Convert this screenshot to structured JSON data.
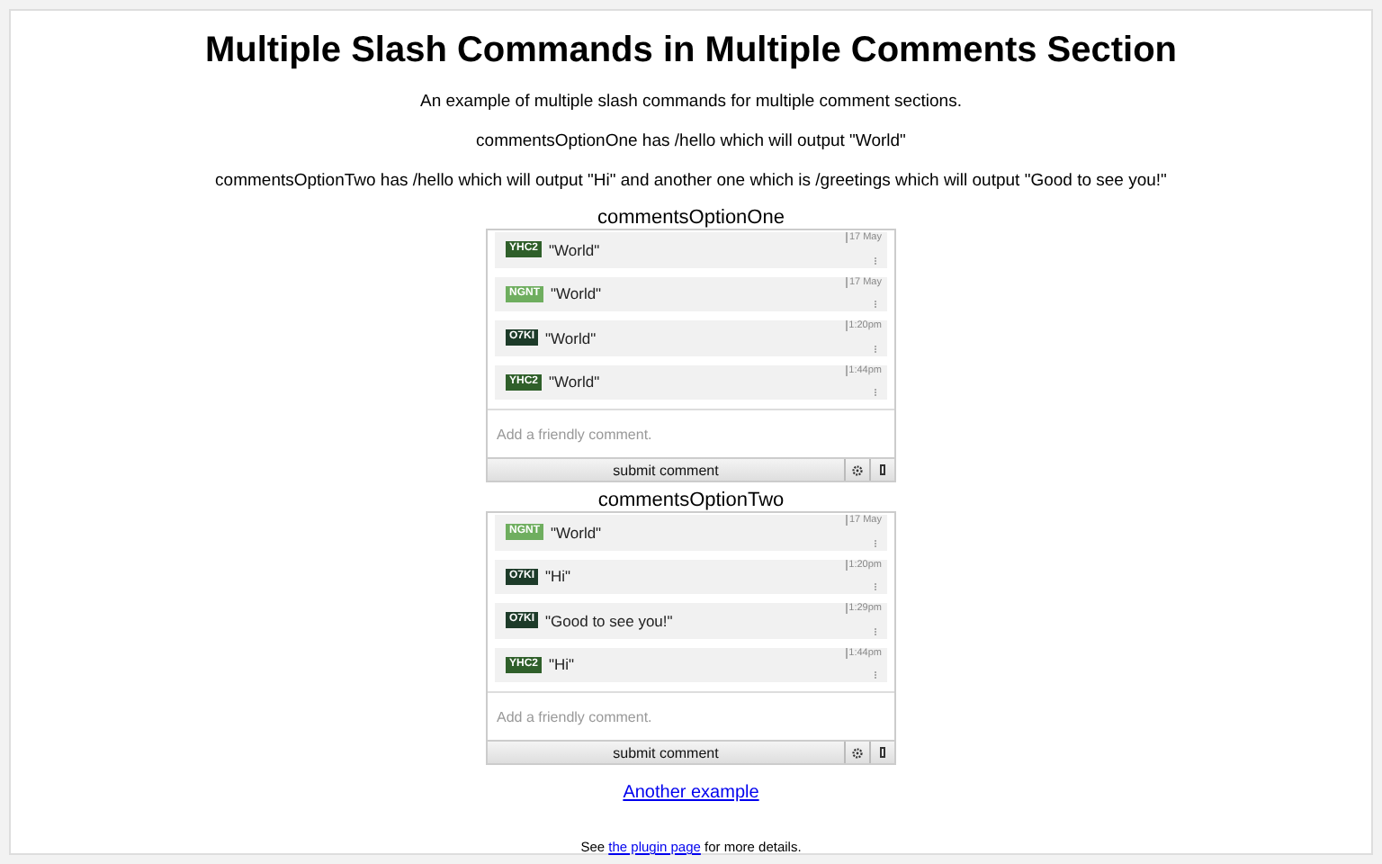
{
  "title": "Multiple Slash Commands in Multiple Comments Section",
  "intro": [
    "An example of multiple slash commands for multiple comment sections.",
    "commentsOptionOne has /hello which will output \"World\"",
    "commentsOptionTwo has /hello which will output \"Hi\" and another one which is /greetings which will output \"Good to see you!\""
  ],
  "sections": [
    {
      "label": "commentsOptionOne",
      "placeholder": "Add a friendly comment.",
      "submit": "submit comment",
      "comments": [
        {
          "user": "YHC2",
          "color": "#2f5f2a",
          "text": "\"World\"",
          "time": "17 May"
        },
        {
          "user": "NGNT",
          "color": "#6fae5f",
          "text": "\"World\"",
          "time": "17 May"
        },
        {
          "user": "O7KI",
          "color": "#1d3b29",
          "text": "\"World\"",
          "time": "1:20pm"
        },
        {
          "user": "YHC2",
          "color": "#2f5f2a",
          "text": "\"World\"",
          "time": "1:44pm"
        }
      ]
    },
    {
      "label": "commentsOptionTwo",
      "placeholder": "Add a friendly comment.",
      "submit": "submit comment",
      "comments": [
        {
          "user": "NGNT",
          "color": "#6fae5f",
          "text": "\"World\"",
          "time": "17 May"
        },
        {
          "user": "O7KI",
          "color": "#1d3b29",
          "text": "\"Hi\"",
          "time": "1:20pm"
        },
        {
          "user": "O7KI",
          "color": "#1d3b29",
          "text": "\"Good to see you!\"",
          "time": "1:29pm"
        },
        {
          "user": "YHC2",
          "color": "#2f5f2a",
          "text": "\"Hi\"",
          "time": "1:44pm"
        }
      ]
    }
  ],
  "another_link": "Another example",
  "footer": {
    "before": "See ",
    "link": "the plugin page",
    "after": " for more details."
  }
}
